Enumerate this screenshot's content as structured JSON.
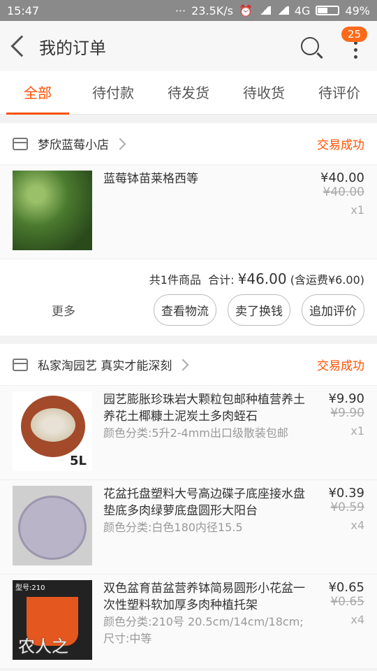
{
  "status_bar": {
    "time": "15:47",
    "speed": "23.5K/s",
    "network": "4G",
    "battery": "49%"
  },
  "header": {
    "title": "我的订单",
    "badge": "25"
  },
  "tabs": [
    "全部",
    "待付款",
    "待发货",
    "待收货",
    "待评价"
  ],
  "orders": [
    {
      "shop": "梦欣蓝莓小店",
      "status": "交易成功",
      "items": [
        {
          "title": "蓝莓钵苗莱格西等",
          "spec": "",
          "price": "¥40.00",
          "orig": "¥40.00",
          "qty": "x1"
        }
      ],
      "summary": {
        "count": "共1件商品",
        "total_label": "合计:",
        "total": "¥46.00",
        "shipping": "(含运费¥6.00)"
      },
      "more": "更多",
      "buttons": [
        "查看物流",
        "卖了换钱",
        "追加评价"
      ]
    },
    {
      "shop": "私家淘园艺 真实才能深刻",
      "status": "交易成功",
      "items": [
        {
          "title": "园艺膨胀珍珠岩大颗粒包邮种植营养土养花土椰糠土泥炭土多肉蛭石",
          "spec": "颜色分类:5升2-4mm出口级散装包邮",
          "price": "¥9.90",
          "orig": "¥9.90",
          "qty": "x1",
          "img_text": "5L"
        },
        {
          "title": "花盆托盘塑料大号高边碟子底座接水盘垫底多肉绿萝底盘圆形大阳台",
          "spec": "颜色分类:白色180内径15.5",
          "price": "¥0.39",
          "orig": "¥0.59",
          "qty": "x4"
        },
        {
          "title": "双色盆育苗盆营养钵简易圆形小花盆一次性塑料软加厚多肉种植托架",
          "spec": "颜色分类:210号 20.5cm/14cm/18cm;尺寸:中等",
          "price": "¥0.65",
          "orig": "¥0.65",
          "qty": "x4",
          "img_text": "型号:210"
        }
      ]
    }
  ],
  "watermark": "农人之"
}
